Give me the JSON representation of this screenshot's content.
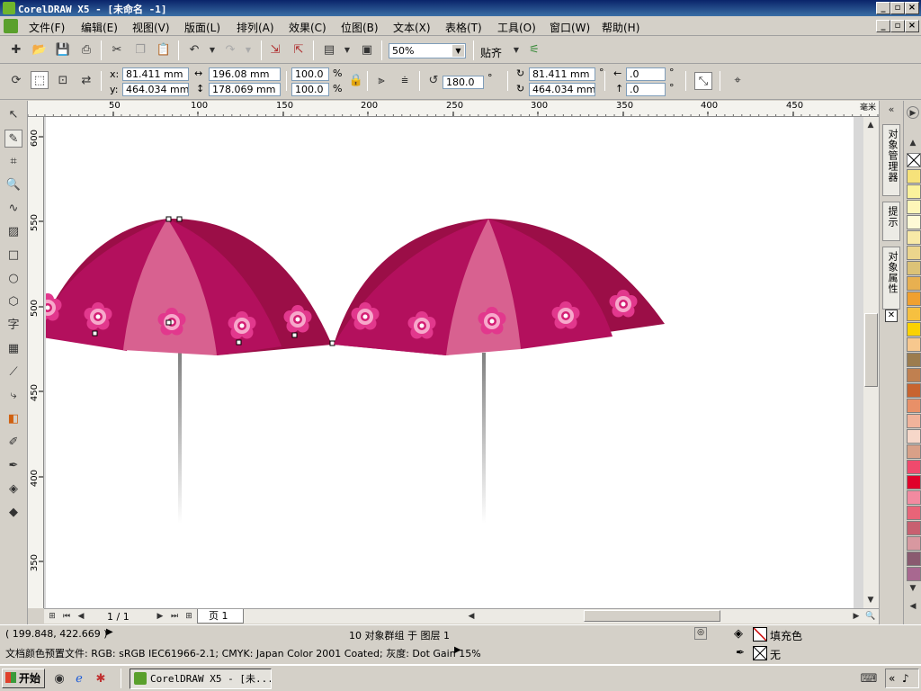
{
  "window": {
    "title": "CorelDRAW X5 - [未命名 -1]"
  },
  "menu": [
    {
      "label": "文件(F)"
    },
    {
      "label": "编辑(E)"
    },
    {
      "label": "视图(V)"
    },
    {
      "label": "版面(L)"
    },
    {
      "label": "排列(A)"
    },
    {
      "label": "效果(C)"
    },
    {
      "label": "位图(B)"
    },
    {
      "label": "文本(X)"
    },
    {
      "label": "表格(T)"
    },
    {
      "label": "工具(O)"
    },
    {
      "label": "窗口(W)"
    },
    {
      "label": "帮助(H)"
    }
  ],
  "toolbar": {
    "zoom_value": "50%",
    "snap_label": "贴齐"
  },
  "property_bar": {
    "x_label": "x:",
    "y_label": "y:",
    "x_value": "81.411 mm",
    "y_value": "464.034 mm",
    "width_value": "196.08 mm",
    "height_value": "178.069 mm",
    "scale_x": "100.0",
    "scale_y": "100.0",
    "percent": "%",
    "angle_value": "180.0",
    "angle_unit": "°",
    "center_x_value": "81.411 mm",
    "center_y_value": "464.034 mm",
    "offset_x_value": ".0",
    "offset_y_value": ".0"
  },
  "ruler": {
    "unit": "毫米",
    "h_ticks": [
      "50",
      "100",
      "150",
      "200",
      "250",
      "300",
      "350",
      "400",
      "450"
    ],
    "v_ticks": [
      "600",
      "550",
      "500",
      "450",
      "400",
      "350"
    ]
  },
  "page_nav": {
    "page_count": "1 / 1",
    "page_tab": "页 1"
  },
  "dockers": {
    "tab1": "对象管理器",
    "tab2": "提示",
    "tab3": "对象属性"
  },
  "status": {
    "coords": "( 199.848, 422.669 )",
    "selection_info": "10 对象群组 于 图层 1",
    "color_profile": "文档颜色预置文件: RGB: sRGB IEC61966-2.1; CMYK: Japan Color 2001 Coated; 灰度: Dot Gain 15%",
    "fill_label": "填充色",
    "outline_label": "无"
  },
  "taskbar": {
    "start_label": "开始",
    "task_label": "CorelDRAW X5 - [未..."
  },
  "palette_colors": [
    "#f6e27a",
    "#fbf29c",
    "#fdf6b8",
    "#fefad6",
    "#f8e9a7",
    "#ecd58c",
    "#dcc277",
    "#e8b050",
    "#f0a030",
    "#f6c040",
    "#fbd200",
    "#f7c88e",
    "#9c7c4e",
    "#c08050",
    "#c86430",
    "#e89068",
    "#f1b39b",
    "#f6d7c9",
    "#d8a088",
    "#f04a6d",
    "#e0002a",
    "#f28aa0",
    "#e86478",
    "#c86070",
    "#d898a0",
    "#8a5a70",
    "#a86890"
  ],
  "colors": {
    "umbrella_dark": "#9b0e47",
    "umbrella_mid": "#b3105d",
    "umbrella_light": "#d86190",
    "flower_petal": "#e2388d",
    "flower_center": "#ffffff",
    "pole": "#8a8a8a"
  }
}
